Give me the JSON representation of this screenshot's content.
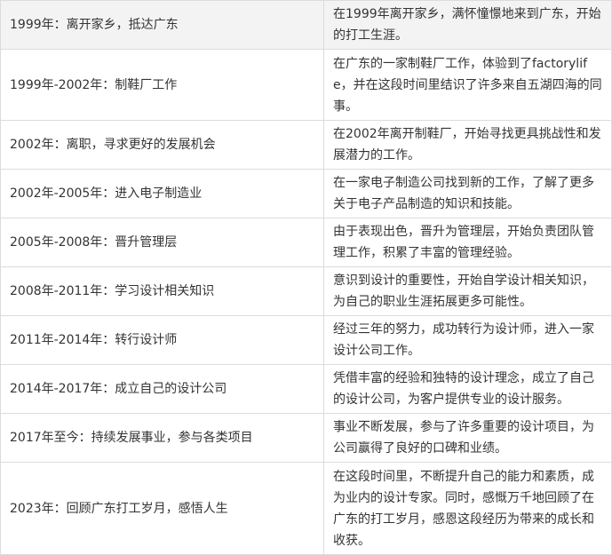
{
  "rows": [
    {
      "period": "1999年：离开家乡，抵达广东",
      "detail": "在1999年离开家乡，满怀憧憬地来到广东，开始的打工生涯。"
    },
    {
      "period": "1999年-2002年：制鞋厂工作",
      "detail": "在广东的一家制鞋厂工作，体验到了factorylife，并在这段时间里结识了许多来自五湖四海的同事。"
    },
    {
      "period": "2002年：离职，寻求更好的发展机会",
      "detail": "在2002年离开制鞋厂，开始寻找更具挑战性和发展潜力的工作。"
    },
    {
      "period": "2002年-2005年：进入电子制造业",
      "detail": "在一家电子制造公司找到新的工作，了解了更多关于电子产品制造的知识和技能。"
    },
    {
      "period": "2005年-2008年：晋升管理层",
      "detail": "由于表现出色，晋升为管理层，开始负责团队管理工作，积累了丰富的管理经验。"
    },
    {
      "period": "2008年-2011年：学习设计相关知识",
      "detail": "意识到设计的重要性，开始自学设计相关知识，为自己的职业生涯拓展更多可能性。"
    },
    {
      "period": "2011年-2014年：转行设计师",
      "detail": "经过三年的努力，成功转行为设计师，进入一家设计公司工作。"
    },
    {
      "period": "2014年-2017年：成立自己的设计公司",
      "detail": "凭借丰富的经验和独特的设计理念，成立了自己的设计公司，为客户提供专业的设计服务。"
    },
    {
      "period": "2017年至今：持续发展事业，参与各类项目",
      "detail": "事业不断发展，参与了许多重要的设计项目，为公司赢得了良好的口碑和业绩。"
    },
    {
      "period": "2023年：回顾广东打工岁月，感悟人生",
      "detail": "在这段时间里，不断提升自己的能力和素质，成为业内的设计专家。同时，感慨万千地回顾了在广东的打工岁月，感恩这段经历为带来的成长和收获。"
    }
  ]
}
